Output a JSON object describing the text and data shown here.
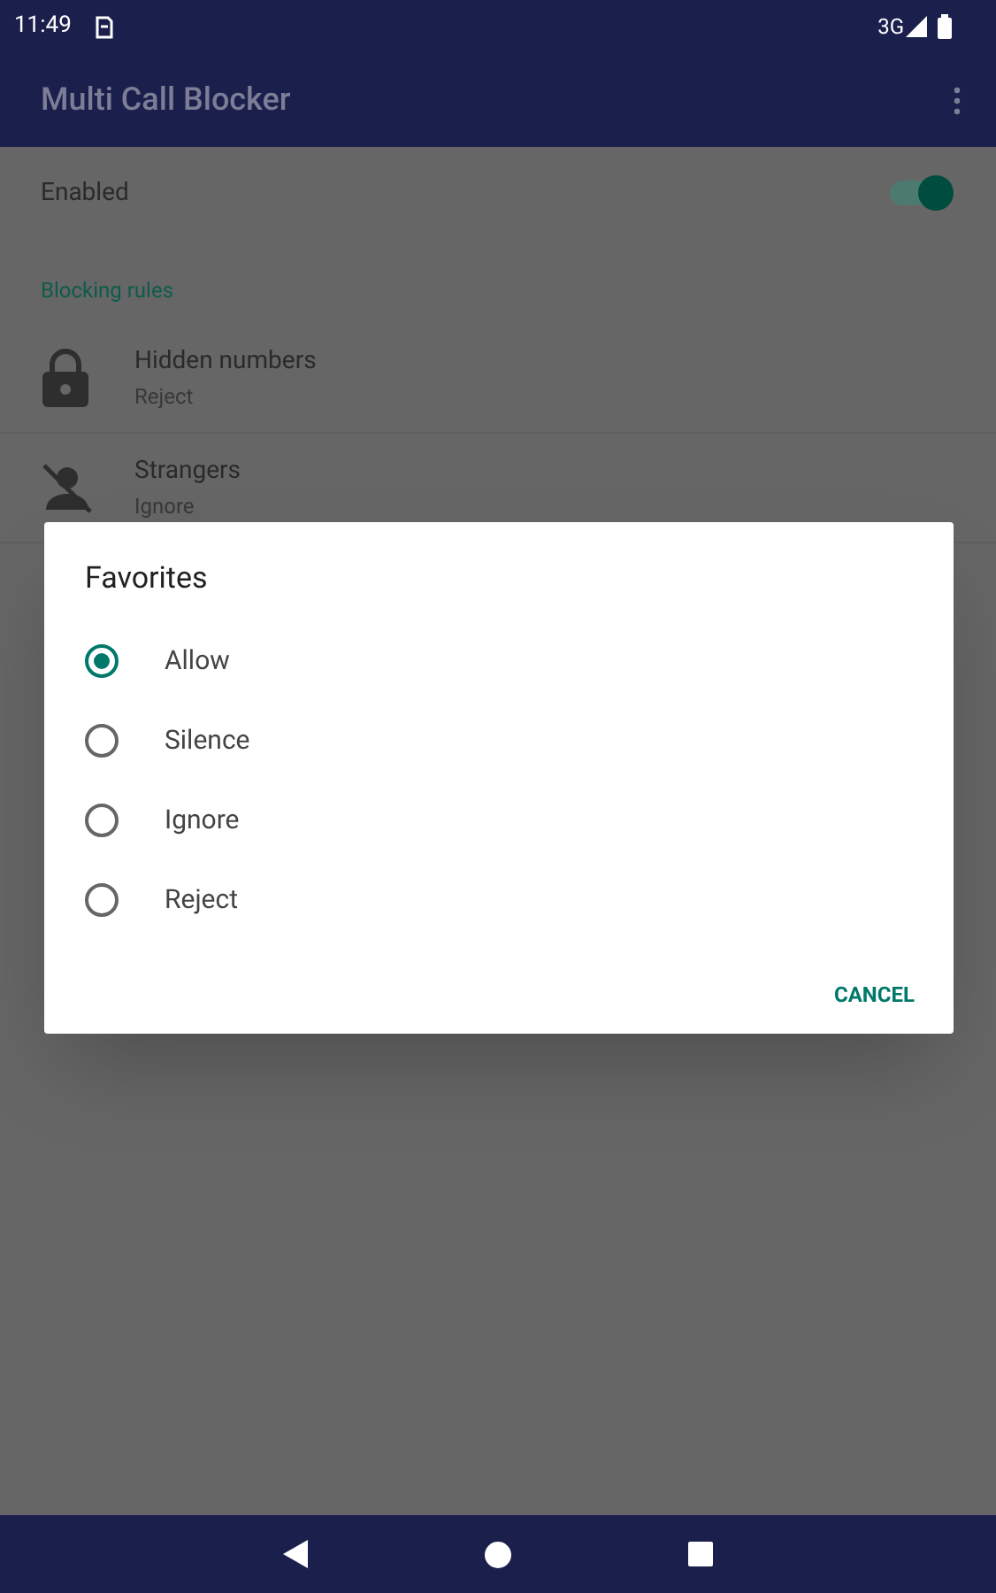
{
  "status_bar": {
    "time": "11:49",
    "network": "3G"
  },
  "app_bar": {
    "title": "Multi Call Blocker"
  },
  "enabled": {
    "label": "Enabled",
    "on": true
  },
  "section": {
    "title": "Blocking rules"
  },
  "rules": [
    {
      "kind": "lock",
      "title": "Hidden numbers",
      "value": "Reject"
    },
    {
      "kind": "person-off",
      "title": "Strangers",
      "value": "Ignore"
    }
  ],
  "dialog": {
    "title": "Favorites",
    "options": [
      {
        "label": "Allow",
        "selected": true
      },
      {
        "label": "Silence",
        "selected": false
      },
      {
        "label": "Ignore",
        "selected": false
      },
      {
        "label": "Reject",
        "selected": false
      }
    ],
    "cancel": "CANCEL"
  }
}
